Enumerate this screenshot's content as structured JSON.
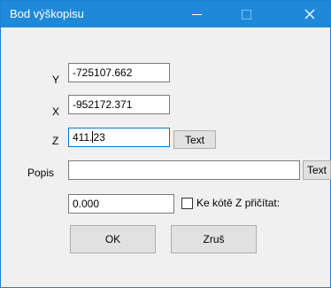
{
  "window": {
    "title": "Bod výškopisu"
  },
  "form": {
    "y_label": "Y",
    "y_value": "-725107.662",
    "x_label": "X",
    "x_value": "-952172.371",
    "z_label": "Z",
    "z_value_before": "411.",
    "z_value_after": "23",
    "z_text_button": "Text",
    "popis_label": "Popis",
    "popis_value": "",
    "popis_text_button": "Text",
    "offset_value": "0.000",
    "add_to_z_label": "Ke kótě Z přičítat:",
    "add_to_z_checked": false
  },
  "actions": {
    "ok_label": "OK",
    "cancel_label": "Zruš"
  }
}
